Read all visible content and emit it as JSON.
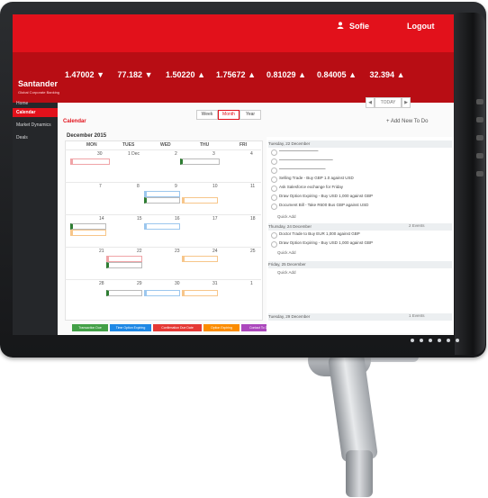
{
  "header": {
    "user_name": "Sofie",
    "logout_label": "Logout",
    "brand": "Santander",
    "brand_sub": "Global Corporate Banking"
  },
  "tickers": [
    {
      "value": "1.47002",
      "arrow": "▼"
    },
    {
      "value": "77.182",
      "arrow": "▼"
    },
    {
      "value": "1.50220",
      "arrow": "▲"
    },
    {
      "value": "1.75672",
      "arrow": "▲"
    },
    {
      "value": "0.81029",
      "arrow": "▲"
    },
    {
      "value": "0.84005",
      "arrow": "▲"
    },
    {
      "value": "32.394",
      "arrow": "▲"
    }
  ],
  "sidebar": {
    "items": [
      "Home",
      "Calendar",
      "Market Dynamics",
      "Deals",
      "",
      "",
      "",
      "",
      "",
      "",
      "",
      "",
      "",
      "",
      ""
    ],
    "active_index": 1
  },
  "calendar": {
    "title": "Calendar",
    "month_label": "December 2015",
    "views": [
      "Week",
      "Month",
      "Year"
    ],
    "selected_view": "Month",
    "weekdays": [
      "MON",
      "TUES",
      "WED",
      "THU",
      "FRI"
    ],
    "day_numbers": [
      "30",
      "1 Dec",
      "2",
      "3",
      "4",
      "7",
      "8",
      "9",
      "10",
      "11",
      "14",
      "15",
      "16",
      "17",
      "18",
      "21",
      "22",
      "23",
      "24",
      "25",
      "28",
      "29",
      "30",
      "31",
      "1"
    ]
  },
  "pager": {
    "prev": "◀",
    "today": "TODAY",
    "next": "▶"
  },
  "todo": {
    "heading": "+ Add New To Do",
    "sections": [
      {
        "label": "Tuesday, 22 December"
      },
      {
        "label": "Thursday, 24 December"
      },
      {
        "label": "Friday, 25 December"
      },
      {
        "label": "Tuesday, 29 December"
      }
    ],
    "add_label": "Quick Add",
    "rows": [
      "Selling Trade - Buy GBP 1.0 against USD",
      "Ask Salesforce exchange for Friday",
      "Draw Option Expiring - Buy USD 1,000 against GBP",
      "Document Bill - Take R600 Bus GBP against USD",
      "Doctor Trade to Buy EUR 1,000 against GBP",
      "Draw Option Expiring - Buy USD 1,000 against GBP"
    ],
    "count_labels": [
      "2 Events",
      "1 Events"
    ]
  },
  "legend": [
    {
      "label": "Transaction Due",
      "color": "#43a047"
    },
    {
      "label": "Time Option Expiring",
      "color": "#1e88e5"
    },
    {
      "label": "Confirmation Due Date",
      "color": "#e53935"
    },
    {
      "label": "Option Expiring",
      "color": "#fb8c00"
    },
    {
      "label": "Contact To Do",
      "color": "#ab47bc"
    }
  ],
  "colors": {
    "brand_red": "#e2111b",
    "dark_red": "#b80d14",
    "sidebar": "#25272a"
  }
}
